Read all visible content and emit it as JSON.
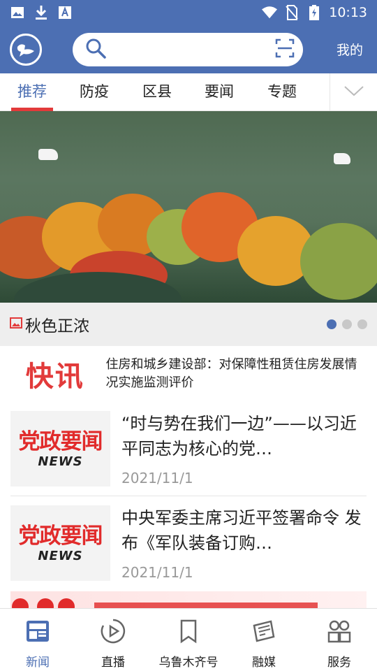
{
  "status_bar": {
    "time": "10:13",
    "left_icons": [
      "image-icon",
      "download-icon",
      "font-a-icon"
    ],
    "right_icons": [
      "wifi-icon",
      "no-sim-icon",
      "battery-charging-icon"
    ]
  },
  "header": {
    "logo_icon": "app-logo-icon",
    "search": {
      "placeholder": "",
      "left_icon": "search-icon",
      "right_icon": "scan-icon"
    },
    "mine_label": "我的"
  },
  "tabs": {
    "items": [
      {
        "label": "推荐",
        "active": true
      },
      {
        "label": "防疫",
        "active": false
      },
      {
        "label": "区县",
        "active": false
      },
      {
        "label": "要闻",
        "active": false
      },
      {
        "label": "专题",
        "active": false
      }
    ],
    "more_icon": "chevron-down-icon"
  },
  "banner": {
    "caption": "秋色正浓",
    "caption_icon": "picture-icon",
    "dots_total": 3,
    "dots_active": 1
  },
  "flash": {
    "tag": "快讯",
    "text": "住房和城乡建设部：对保障性租赁住房发展情况实施监测评价"
  },
  "news": [
    {
      "thumb_title": "党政要闻",
      "thumb_sub": "NEWS",
      "title": "“时与势在我们一边”——以习近平同志为核心的党…",
      "date": "2021/11/1"
    },
    {
      "thumb_title": "党政要闻",
      "thumb_sub": "NEWS",
      "title": "中央军委主席习近平签署命令 发布《军队装备订购…",
      "date": "2021/11/1"
    }
  ],
  "bottom_nav": [
    {
      "label": "新闻",
      "icon": "newspaper-icon",
      "active": true
    },
    {
      "label": "直播",
      "icon": "play-circle-icon",
      "active": false
    },
    {
      "label": "乌鲁木齐号",
      "icon": "bookmark-icon",
      "active": false
    },
    {
      "label": "融媒",
      "icon": "news-paper-stack-icon",
      "active": false
    },
    {
      "label": "服务",
      "icon": "people-icon",
      "active": false
    }
  ],
  "colors": {
    "brand": "#4c6fb3",
    "accent_red": "#e23a3a",
    "text": "#222222",
    "muted": "#999999"
  }
}
